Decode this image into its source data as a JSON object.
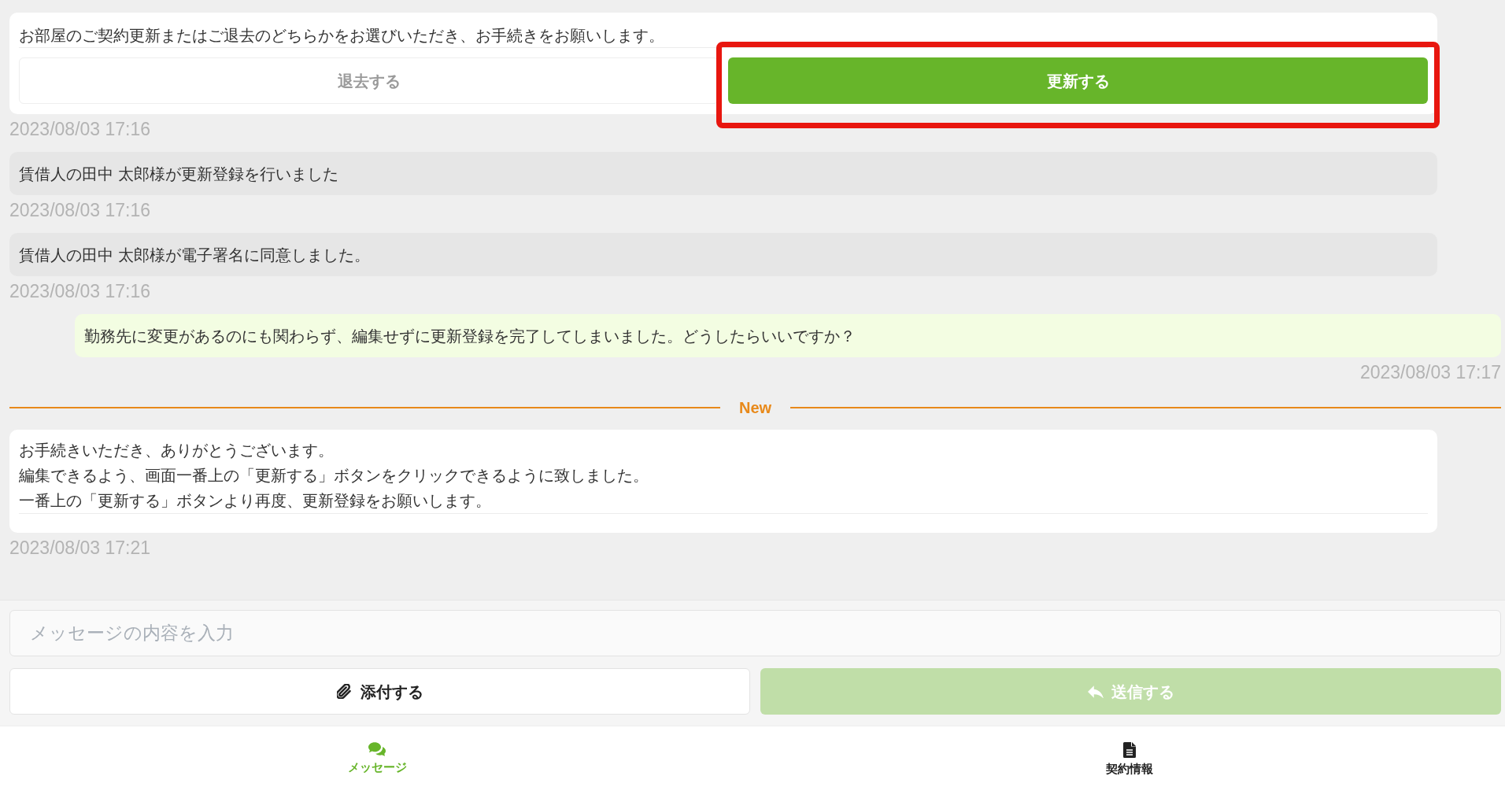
{
  "messages": [
    {
      "kind": "action",
      "text": "お部屋のご契約更新またはご退去のどちらかをお選びいただき、お手続きをお願いします。",
      "buttons": [
        {
          "label": "退去する",
          "kind": "secondary",
          "disabled": true,
          "highlighted": false
        },
        {
          "label": "更新する",
          "kind": "primary",
          "disabled": false,
          "highlighted": true
        }
      ],
      "time": "2023/08/03 17:16"
    },
    {
      "kind": "system",
      "text": "賃借人の田中 太郎様が更新登録を行いました",
      "time": "2023/08/03 17:16"
    },
    {
      "kind": "system",
      "text": "賃借人の田中 太郎様が電子署名に同意しました。",
      "time": "2023/08/03 17:16"
    },
    {
      "kind": "user",
      "text": "勤務先に変更があるのにも関わらず、編集せずに更新登録を完了してしまいました。どうしたらいいですか？",
      "time": "2023/08/03 17:17"
    },
    {
      "kind": "divider",
      "label": "New"
    },
    {
      "kind": "staff",
      "lines": [
        "お手続きいただき、ありがとうございます。",
        "編集できるよう、画面一番上の「更新する」ボタンをクリックできるように致しました。",
        "一番上の「更新する」ボタンより再度、更新登録をお願いします。"
      ],
      "time": "2023/08/03 17:21"
    }
  ],
  "composer": {
    "placeholder": "メッセージの内容を入力",
    "attach_button": {
      "label": "添付する"
    },
    "send_button": {
      "label": "送信する",
      "disabled": true
    }
  },
  "nav": [
    {
      "label": "メッセージ",
      "selected": true
    },
    {
      "label": "契約情報",
      "selected": false
    }
  ]
}
